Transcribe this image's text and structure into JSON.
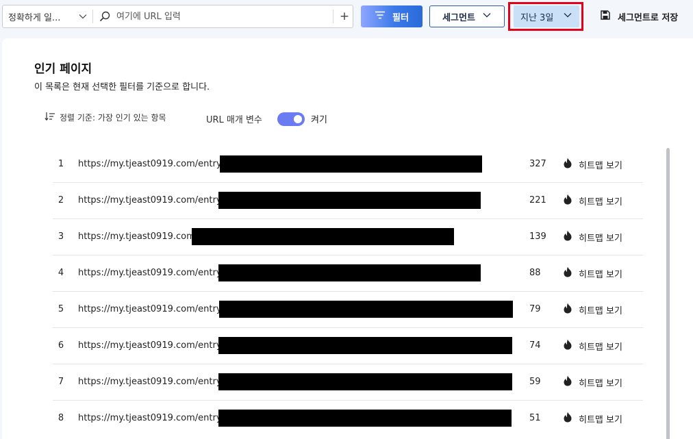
{
  "toolbar": {
    "match_mode": "정확하게 일...",
    "url_placeholder": "여기에 URL 입력",
    "add_label": "+",
    "filter_label": "필터",
    "segment_label": "세그먼트",
    "date_range": "지난 3일",
    "save_segment_label": "세그먼트로 저장",
    "colors": {
      "accent": "#2a6bd9",
      "highlight": "#e2001a",
      "date_bg": "#c9e0f7"
    }
  },
  "card": {
    "title": "인기 페이지",
    "subtitle": "이 목록은 현재 선택한 필터를 기준으로 합니다.",
    "sort_label": "정렬 기준: 가장 인기 있는 항목",
    "url_params_label": "URL 매개 변수",
    "url_params_state": "켜기",
    "url_params_on": true
  },
  "pages": [
    {
      "rank": "1",
      "url": "https://my.tjeast0919.com/entry/",
      "count": "327",
      "action": "히트맵 보기"
    },
    {
      "rank": "2",
      "url": "https://my.tjeast0919.com/entry/",
      "count": "221",
      "action": "히트맵 보기"
    },
    {
      "rank": "3",
      "url": "https://my.tjeast0919.com/",
      "count": "139",
      "action": "히트맵 보기"
    },
    {
      "rank": "4",
      "url": "https://my.tjeast0919.com/entry/",
      "count": "88",
      "action": "히트맵 보기"
    },
    {
      "rank": "5",
      "url": "https://my.tjeast0919.com/entry/",
      "count": "79",
      "action": "히트맵 보기"
    },
    {
      "rank": "6",
      "url": "https://my.tjeast0919.com/entry/",
      "count": "74",
      "action": "히트맵 보기"
    },
    {
      "rank": "7",
      "url": "https://my.tjeast0919.com/entry/",
      "count": "59",
      "action": "히트맵 보기"
    },
    {
      "rank": "8",
      "url": "https://my.tjeast0919.com/entry/",
      "count": "51",
      "action": "히트맵 보기"
    }
  ],
  "icons": {
    "search": "search-icon",
    "chevron": "chevron-down-icon",
    "filter": "filter-icon",
    "save": "save-icon",
    "sort": "sort-icon",
    "heatmap": "flame-icon"
  }
}
